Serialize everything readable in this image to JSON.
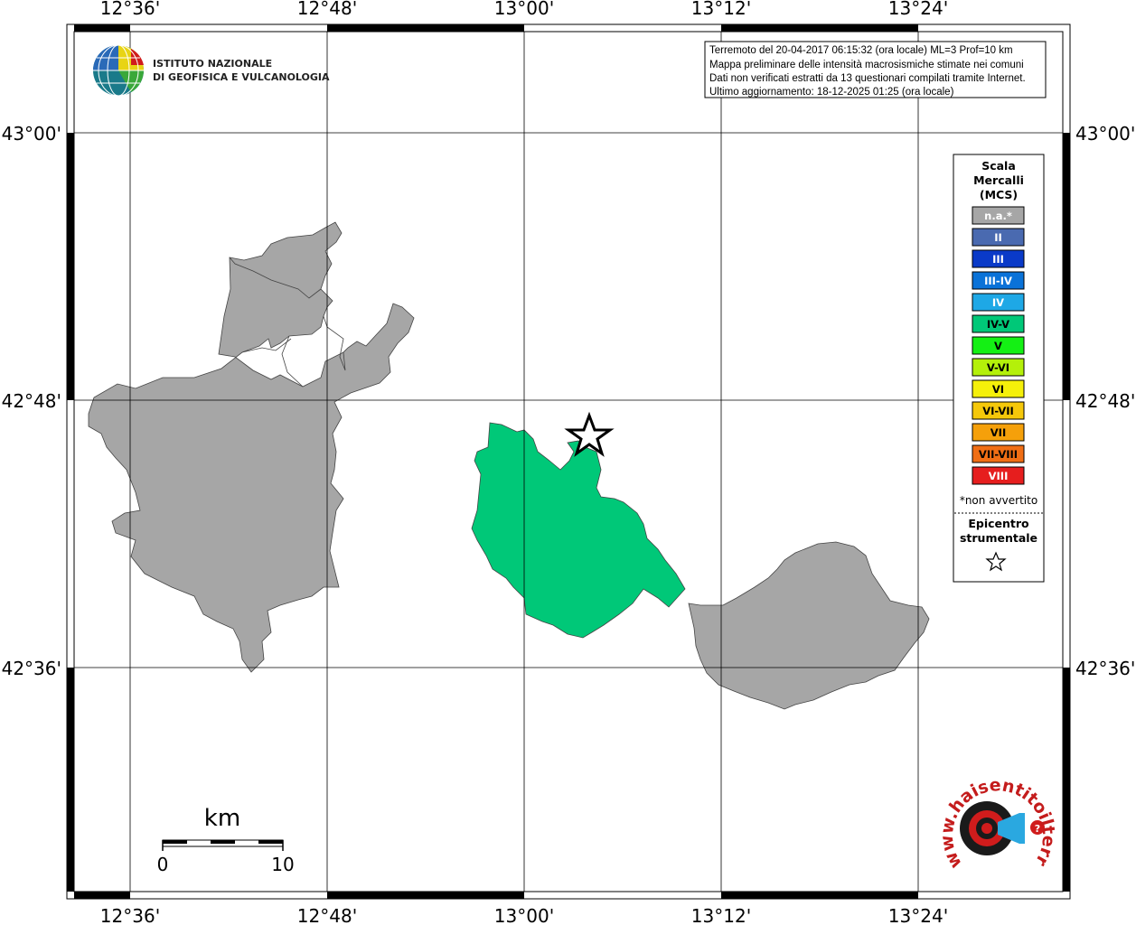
{
  "map": {
    "lon_labels": [
      "12°36'",
      "12°48'",
      "13°00'",
      "13°12'",
      "13°24'"
    ],
    "lat_labels": [
      "43°00'",
      "42°48'",
      "42°36'"
    ]
  },
  "institute": {
    "line1": "ISTITUTO NAZIONALE",
    "line2": "DI GEOFISICA E VULCANOLOGIA"
  },
  "info": {
    "line1": "Terremoto del 20-04-2017 06:15:32 (ora locale) ML=3 Prof=10 km",
    "line2": "Mappa preliminare delle intensità macrosismiche stimate nei comuni",
    "line3": "Dati non verificati estratti da 13 questionari compilati tramite Internet.",
    "line4": "Ultimo aggiornamento: 18-12-2025 01:25 (ora locale)"
  },
  "legend": {
    "title_line1": "Scala",
    "title_line2": "Mercalli",
    "title_line3": "(MCS)",
    "items": [
      {
        "label": "n.a.*",
        "color": "#a6a6a6",
        "text_color": "#ffffff"
      },
      {
        "label": "II",
        "color": "#4a6ab0",
        "text_color": "#ffffff"
      },
      {
        "label": "III",
        "color": "#0a3ac8",
        "text_color": "#ffffff"
      },
      {
        "label": "III-IV",
        "color": "#0a72d8",
        "text_color": "#ffffff"
      },
      {
        "label": "IV",
        "color": "#1ea8e6",
        "text_color": "#ffffff"
      },
      {
        "label": "IV-V",
        "color": "#00c878",
        "text_color": "#000000"
      },
      {
        "label": "V",
        "color": "#14f014",
        "text_color": "#000000"
      },
      {
        "label": "V-VI",
        "color": "#b4f00a",
        "text_color": "#000000"
      },
      {
        "label": "VI",
        "color": "#f5f00a",
        "text_color": "#000000"
      },
      {
        "label": "VI-VII",
        "color": "#f5c80a",
        "text_color": "#000000"
      },
      {
        "label": "VII",
        "color": "#f5a00a",
        "text_color": "#000000"
      },
      {
        "label": "VII-VIII",
        "color": "#f06e14",
        "text_color": "#000000"
      },
      {
        "label": "VIII",
        "color": "#e61e1e",
        "text_color": "#ffffff"
      }
    ],
    "note": "*non avvertito",
    "epicenter_line1": "Epicentro",
    "epicenter_line2": "strumentale"
  },
  "scale_bar": {
    "unit": "km",
    "min": "0",
    "max": "10"
  },
  "hst_logo": {
    "text": "www.haisentitoilterremoto.it"
  },
  "regions": [
    {
      "name": "west-municipality",
      "intensity": "n.a.*",
      "color": "#a6a6a6"
    },
    {
      "name": "epicentral-municipality",
      "intensity": "IV-V",
      "color": "#00c878"
    },
    {
      "name": "southeast-municipality",
      "intensity": "n.a.*",
      "color": "#a6a6a6"
    }
  ]
}
